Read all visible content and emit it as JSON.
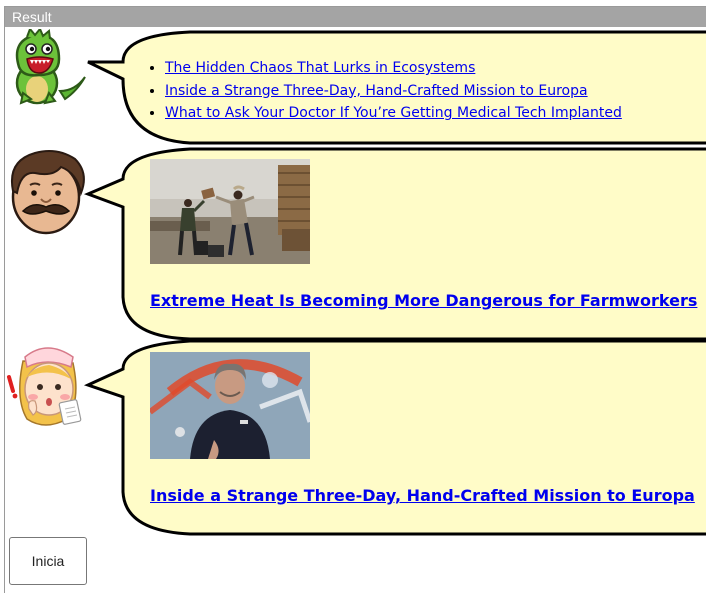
{
  "window": {
    "title": "Result"
  },
  "feed": {
    "first": {
      "avatar_icon": "green-dinosaur-icon",
      "links": [
        "The Hidden Chaos That Lurks in Ecosystems",
        "Inside a Strange Three-Day, Hand-Crafted Mission to Europa",
        "What to Ask Your Doctor If You’re Getting Medical Tech Implanted"
      ]
    },
    "second": {
      "avatar_icon": "mustache-man-icon",
      "image": "farmworkers-throwing-crates-photo",
      "headline": "Extreme Heat Is Becoming More Dangerous for Farmworkers"
    },
    "third": {
      "avatar_icon": "surprised-nurse-icon",
      "image": "man-kneeling-on-logo-photo",
      "headline": "Inside a Strange Three-Day, Hand-Crafted Mission to Europa"
    }
  },
  "controls": {
    "start_label": "Inicia"
  },
  "colors": {
    "bubble_fill": "#fffcc8",
    "bubble_stroke": "#000000",
    "link": "#0000ee",
    "titlebar": "#a4a4a4"
  }
}
